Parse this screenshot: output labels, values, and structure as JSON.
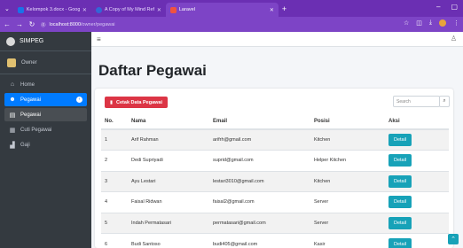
{
  "browser": {
    "tabs": [
      {
        "title": "Kelompok 3.docx - Google Dri",
        "color": "#1a73e8"
      },
      {
        "title": "A Copy of My Mind Reference",
        "color": "#3367d6"
      },
      {
        "title": "Laravel",
        "color": "#f05340"
      }
    ],
    "url_host": "localhost",
    "url_port": ":8000",
    "url_path": "/owner/pegawai"
  },
  "sidebar": {
    "brand": "SIMPEG",
    "user": "Owner",
    "items": [
      {
        "label": "Home",
        "icon": "home-icon"
      },
      {
        "label": "Pegawai",
        "icon": "users-icon"
      },
      {
        "label": "Pegawai",
        "icon": "id-card-icon"
      },
      {
        "label": "Cuti Pegawai",
        "icon": "calendar-icon"
      },
      {
        "label": "Gaji",
        "icon": "money-icon"
      }
    ]
  },
  "main": {
    "title": "Daftar Pegawai",
    "print_label": "Cetak Data Pegawai",
    "search_placeholder": "Search",
    "headers": [
      "No.",
      "Nama",
      "Email",
      "Posisi",
      "Aksi"
    ],
    "rows": [
      {
        "no": "1",
        "nama": "Arif Rahman",
        "email": "arifrh@gmail.com",
        "posisi": "Kitchen",
        "aksi": "Detail"
      },
      {
        "no": "2",
        "nama": "Dedi Supriyadi",
        "email": "suprid@gmail.com",
        "posisi": "Helper Kitchen",
        "aksi": "Detail"
      },
      {
        "no": "3",
        "nama": "Ayu Lestari",
        "email": "lestari3010@gmail.com",
        "posisi": "Kitchen",
        "aksi": "Detail"
      },
      {
        "no": "4",
        "nama": "Faisal Ridwan",
        "email": "faisal2@gmail.com",
        "posisi": "Server",
        "aksi": "Detail"
      },
      {
        "no": "5",
        "nama": "Indah Permatasari",
        "email": "permatasari@gmail.com",
        "posisi": "Server",
        "aksi": "Detail"
      },
      {
        "no": "6",
        "nama": "Budi Santoso",
        "email": "budi405@gmail.com",
        "posisi": "Kasir",
        "aksi": "Detail"
      }
    ]
  },
  "colors": {
    "chrome": "#7d44c6",
    "sidebar": "#343a40",
    "active": "#007bff",
    "danger": "#dc3545",
    "info": "#17a2b8"
  }
}
